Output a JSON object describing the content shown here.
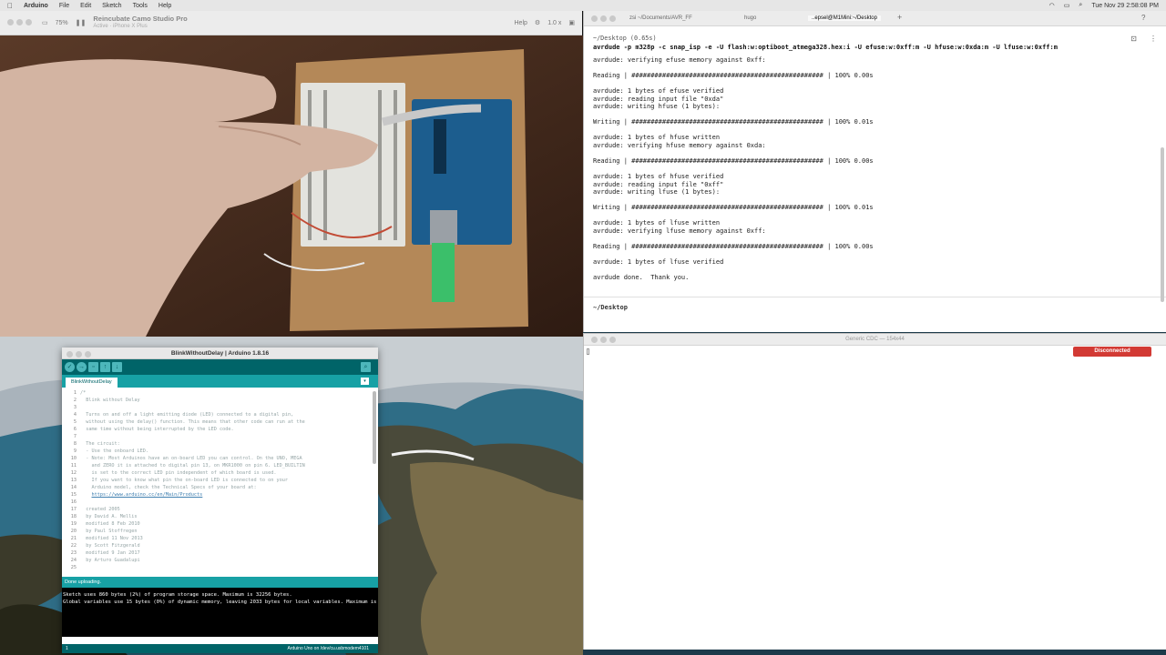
{
  "menubar": {
    "app": "Arduino",
    "items": [
      "File",
      "Edit",
      "Sketch",
      "Tools",
      "Help"
    ],
    "clock": "Tue Nov 29  2:58:08 PM"
  },
  "camo": {
    "zoom": "75%",
    "title": "Reincubate Camo Studio Pro",
    "subtitle": "Active · iPhone X Plus",
    "help": "Help",
    "scale": "1.0 x"
  },
  "terminal": {
    "tabs": [
      {
        "label": "zsi ~/Documents/AVR_FF"
      },
      {
        "label": "hugo"
      },
      {
        "label": "..epsel@M1Mini:~/Desktop"
      }
    ],
    "add_tab": "+",
    "cmd_header": "~/Desktop (0.65s)",
    "command": "avrdude -p m328p -c snap_isp -e -U flash:w:optiboot_atmega328.hex:i -U efuse:w:0xff:m -U hfuse:w:0xda:m -U lfuse:w:0xff:m",
    "output": [
      "avrdude: verifying efuse memory against 0xff:",
      "",
      "Reading | ################################################## | 100% 0.00s",
      "",
      "avrdude: 1 bytes of efuse verified",
      "avrdude: reading input file \"0xda\"",
      "avrdude: writing hfuse (1 bytes):",
      "",
      "Writing | ################################################## | 100% 0.01s",
      "",
      "avrdude: 1 bytes of hfuse written",
      "avrdude: verifying hfuse memory against 0xda:",
      "",
      "Reading | ################################################## | 100% 0.00s",
      "",
      "avrdude: 1 bytes of hfuse verified",
      "avrdude: reading input file \"0xff\"",
      "avrdude: writing lfuse (1 bytes):",
      "",
      "Writing | ################################################## | 100% 0.01s",
      "",
      "avrdude: 1 bytes of lfuse written",
      "avrdude: verifying lfuse memory against 0xff:",
      "",
      "Reading | ################################################## | 100% 0.00s",
      "",
      "avrdude: 1 bytes of lfuse verified",
      "",
      "avrdude done.  Thank you."
    ],
    "prompt": "~/Desktop"
  },
  "serial": {
    "title": "Generic CDC — 154x44",
    "button": "Disconnected"
  },
  "arduino": {
    "title": "BlinkWithoutDelay | Arduino 1.8.16",
    "tab": "BlinkWithoutDelay",
    "tab_menu": "▾",
    "line_numbers": "1\n2\n3\n4\n5\n6\n7\n8\n9\n10\n11\n12\n13\n14\n15\n16\n17\n18\n19\n20\n21\n22\n23\n24\n25",
    "code_lines": [
      "/*",
      "  Blink without Delay",
      "",
      "  Turns on and off a light emitting diode (LED) connected to a digital pin,",
      "  without using the delay() function. This means that other code can run at the",
      "  same time without being interrupted by the LED code.",
      "",
      "  The circuit:",
      "  - Use the onboard LED.",
      "  - Note: Most Arduinos have an on-board LED you can control. On the UNO, MEGA",
      "    and ZERO it is attached to digital pin 13, on MKR1000 on pin 6. LED_BUILTIN",
      "    is set to the correct LED pin independent of which board is used.",
      "    If you want to know what pin the on-board LED is connected to on your",
      "    Arduino model, check the Technical Specs of your board at:",
      "",
      "",
      "  created 2005",
      "  by David A. Mellis",
      "  modified 8 Feb 2010",
      "  by Paul Stoffregen",
      "  modified 11 Nov 2013",
      "  by Scott Fitzgerald",
      "  modified 9 Jan 2017",
      "  by Arturo Guadalupi",
      ""
    ],
    "link": "https://www.arduino.cc/en/Main/Products",
    "status": "Done uploading.",
    "console": "Sketch uses 860 bytes (2%) of program storage space. Maximum is 32256 bytes.\nGlobal variables use 15 bytes (0%) of dynamic memory, leaving 2033 bytes for local variables. Maximum is 2048 bytes.",
    "footer_line": "1",
    "footer_board": "Arduino Uno on /dev/cu.usbmodem4101"
  }
}
